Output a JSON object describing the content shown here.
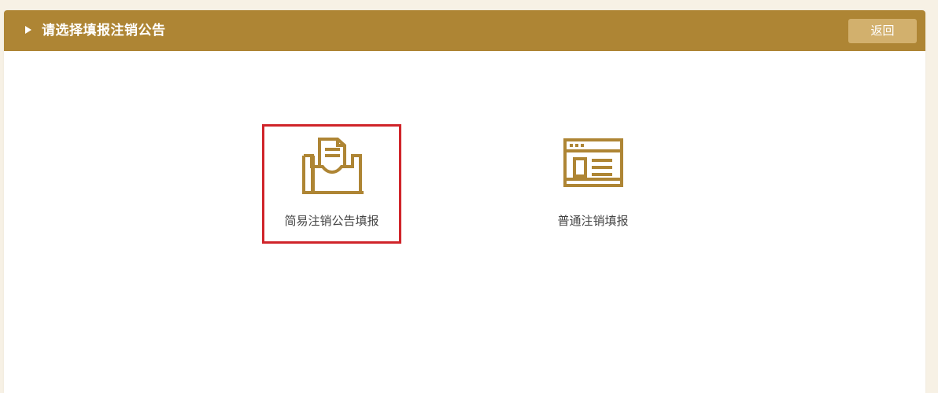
{
  "header": {
    "title": "请选择填报注销公告",
    "back_label": "返回"
  },
  "options": [
    {
      "label": "简易注销公告填报",
      "icon": "inbox-document-icon",
      "selected": true
    },
    {
      "label": "普通注销填报",
      "icon": "browser-window-icon",
      "selected": false
    }
  ],
  "colors": {
    "accent": "#ae8534",
    "button": "#d2b06d",
    "selection": "#d0242a",
    "background": "#f7f1e5"
  }
}
